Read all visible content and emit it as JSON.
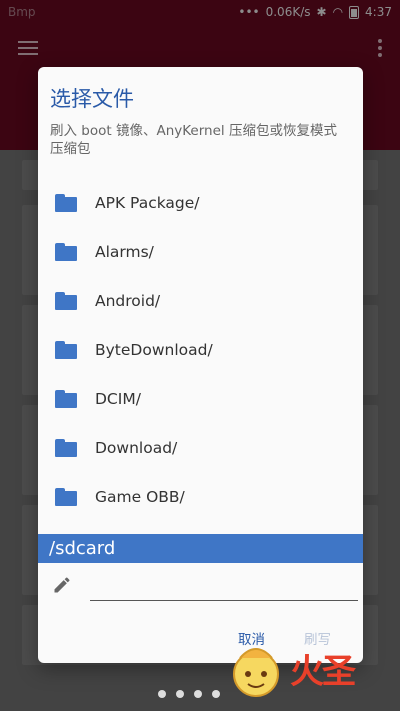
{
  "status_bar": {
    "left_text": "Bmp",
    "network_speed": "0.06K/s",
    "time": "4:37"
  },
  "dialog": {
    "title": "选择文件",
    "subtitle": "刷入 boot 镜像、AnyKernel 压缩包或恢复模式压缩包",
    "items": [
      {
        "name": "APK Package/"
      },
      {
        "name": "Alarms/"
      },
      {
        "name": "Android/"
      },
      {
        "name": "ByteDownload/"
      },
      {
        "name": "DCIM/"
      },
      {
        "name": "Download/"
      },
      {
        "name": "Game OBB/"
      }
    ],
    "current_path": "/sdcard",
    "filename_value": "",
    "cancel_label": "取消",
    "flash_label": "刷写"
  },
  "watermark_text": "火圣",
  "colors": {
    "app_bar": "#6e0a22",
    "accent": "#3f76c6",
    "title": "#2a5aa8"
  }
}
